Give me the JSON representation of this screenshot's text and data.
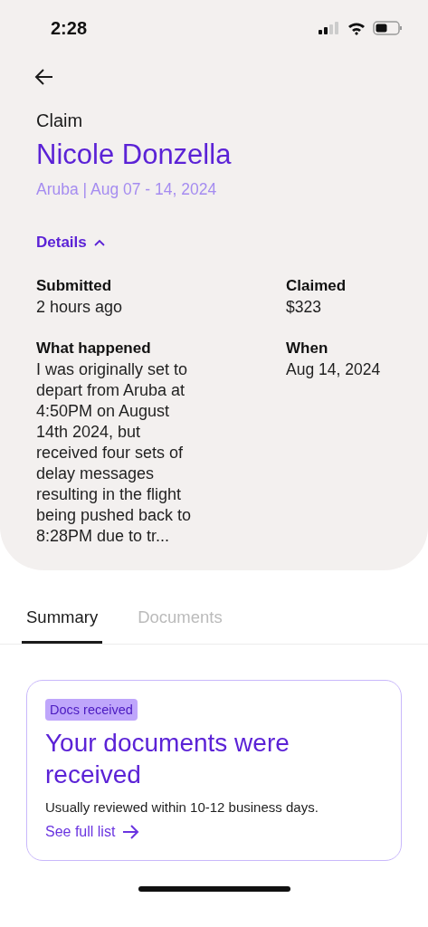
{
  "status_bar": {
    "time": "2:28"
  },
  "header": {
    "label": "Claim",
    "name": "Nicole Donzella",
    "trip": "Aruba | Aug 07 - 14, 2024",
    "details_toggle": {
      "label": "Details",
      "expanded": true
    }
  },
  "details": [
    {
      "label": "Submitted",
      "value": "2 hours ago"
    },
    {
      "label": "Claimed",
      "value": "$323"
    },
    {
      "label": "What happened",
      "value": "I was originally set to depart from Aruba at 4:50PM on August 14th 2024, but received four sets of delay messages resulting in the flight being pushed back to 8:28PM due to tr..."
    },
    {
      "label": "When",
      "value": "Aug 14, 2024"
    }
  ],
  "tabs": [
    {
      "label": "Summary",
      "selected": true
    },
    {
      "label": "Documents",
      "selected": false
    }
  ],
  "card": {
    "badge": "Docs received",
    "title": "Your documents were received",
    "note": "Usually reviewed within 10-12 business days.",
    "link": "See full list"
  }
}
